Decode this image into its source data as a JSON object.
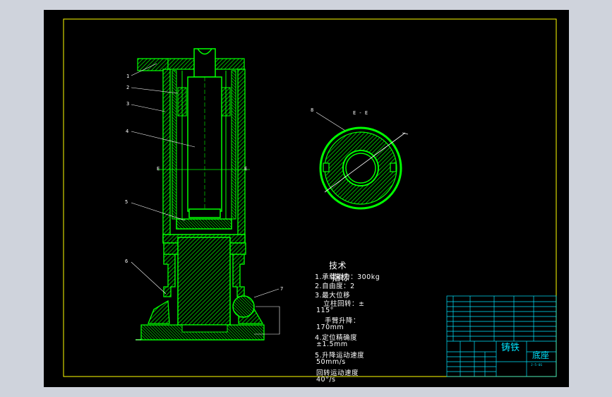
{
  "drawing": {
    "section_label": "E - E",
    "section_mark_left": "E",
    "section_mark_right": "E",
    "callouts": [
      "1",
      "2",
      "3",
      "4",
      "5",
      "6",
      "7",
      "8"
    ]
  },
  "tech_notes": {
    "title_line1": "技术",
    "title_line2": "指标",
    "lines": [
      "1.承载能力：300kg",
      "2.自由度：2",
      "3.最大位移",
      "立柱回转：±",
      "115°",
      "手臂升降：",
      "170mm",
      "4.定位精确度",
      "±1.5mm",
      "5.升降运动速度",
      "50mm/s",
      "回转运动速度",
      "40°/s"
    ]
  },
  "title_block": {
    "material": "铸铁",
    "part_name": "底座",
    "drawing_no": "J-5-01",
    "bom_rows": 8
  },
  "colors": {
    "background": "#000000",
    "outline": "#00ff00",
    "frame": "#ffff00",
    "annotation": "#ffffff",
    "title_block": "#00e5ff",
    "window": "#cfd3dc"
  }
}
